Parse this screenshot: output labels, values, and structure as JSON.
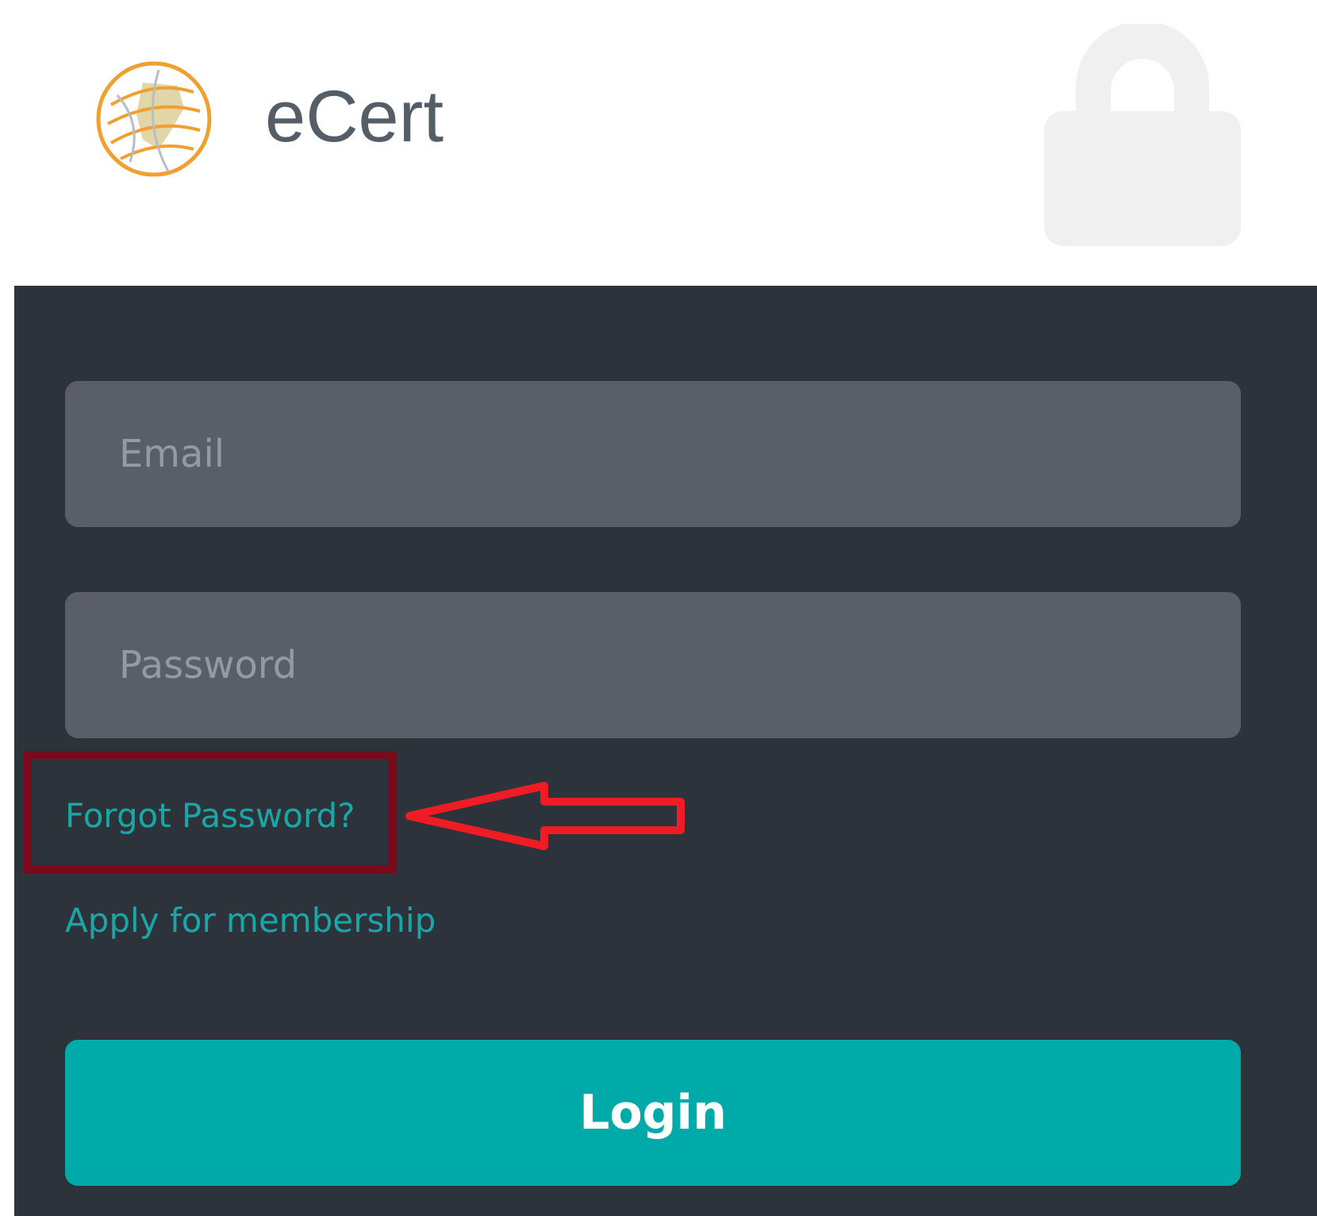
{
  "header": {
    "brand": "eCert"
  },
  "fields": [
    {
      "placeholder": "Email"
    },
    {
      "placeholder": "Password"
    }
  ],
  "links": [
    {
      "label": "Forgot Password?",
      "highlighted": true
    },
    {
      "label": "Apply for membership",
      "highlighted": false
    }
  ],
  "submit": {
    "label": "Login"
  }
}
